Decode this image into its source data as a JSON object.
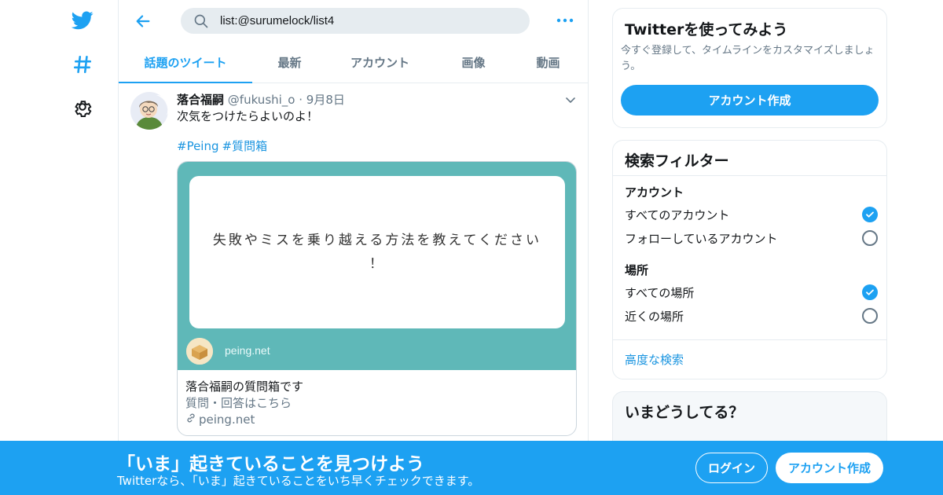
{
  "search": {
    "value": "list:@surumelock/list4"
  },
  "tabs": [
    {
      "label": "話題のツイート"
    },
    {
      "label": "最新"
    },
    {
      "label": "アカウント"
    },
    {
      "label": "画像"
    },
    {
      "label": "動画"
    }
  ],
  "tweet": {
    "name": "落合福嗣",
    "handle": "@fukushi_o",
    "separator": " · ",
    "date": "9月8日",
    "text": "次気をつけたらよいのよ！",
    "hashtags": [
      "#Peing",
      "#質問箱"
    ],
    "card": {
      "question_line1": "失敗やミスを乗り越える方法を教えてください",
      "question_line2": "！",
      "image_domain": "peing.net",
      "title": "落合福嗣の質問箱です",
      "description": "質問・回答はこちら",
      "link": "peing.net"
    }
  },
  "signup_card": {
    "title": "Twitterを使ってみよう",
    "subtitle": "今すぐ登録して、タイムラインをカスタマイズしましょう。",
    "button": "アカウント作成"
  },
  "filter": {
    "title": "検索フィルター",
    "account_section": "アカウント",
    "account_options": [
      {
        "label": "すべてのアカウント",
        "selected": true
      },
      {
        "label": "フォローしているアカウント",
        "selected": false
      }
    ],
    "location_section": "場所",
    "location_options": [
      {
        "label": "すべての場所",
        "selected": true
      },
      {
        "label": "近くの場所",
        "selected": false
      }
    ],
    "advanced": "高度な検索"
  },
  "trends": {
    "title": "いまどうしてる？"
  },
  "banner": {
    "title": "「いま」起きていることを見つけよう",
    "subtitle": "Twitterなら、「いま」起きていることをいち早くチェックできます。",
    "login": "ログイン",
    "signup": "アカウント作成"
  },
  "colors": {
    "accent": "#1da1f2",
    "card_bg": "#5fb8b8"
  },
  "icons": [
    "twitter-bird-icon",
    "hashtag-icon",
    "gear-icon",
    "back-arrow-icon",
    "search-icon",
    "more-icon",
    "chevron-down-icon",
    "link-icon",
    "checkmark-icon"
  ]
}
